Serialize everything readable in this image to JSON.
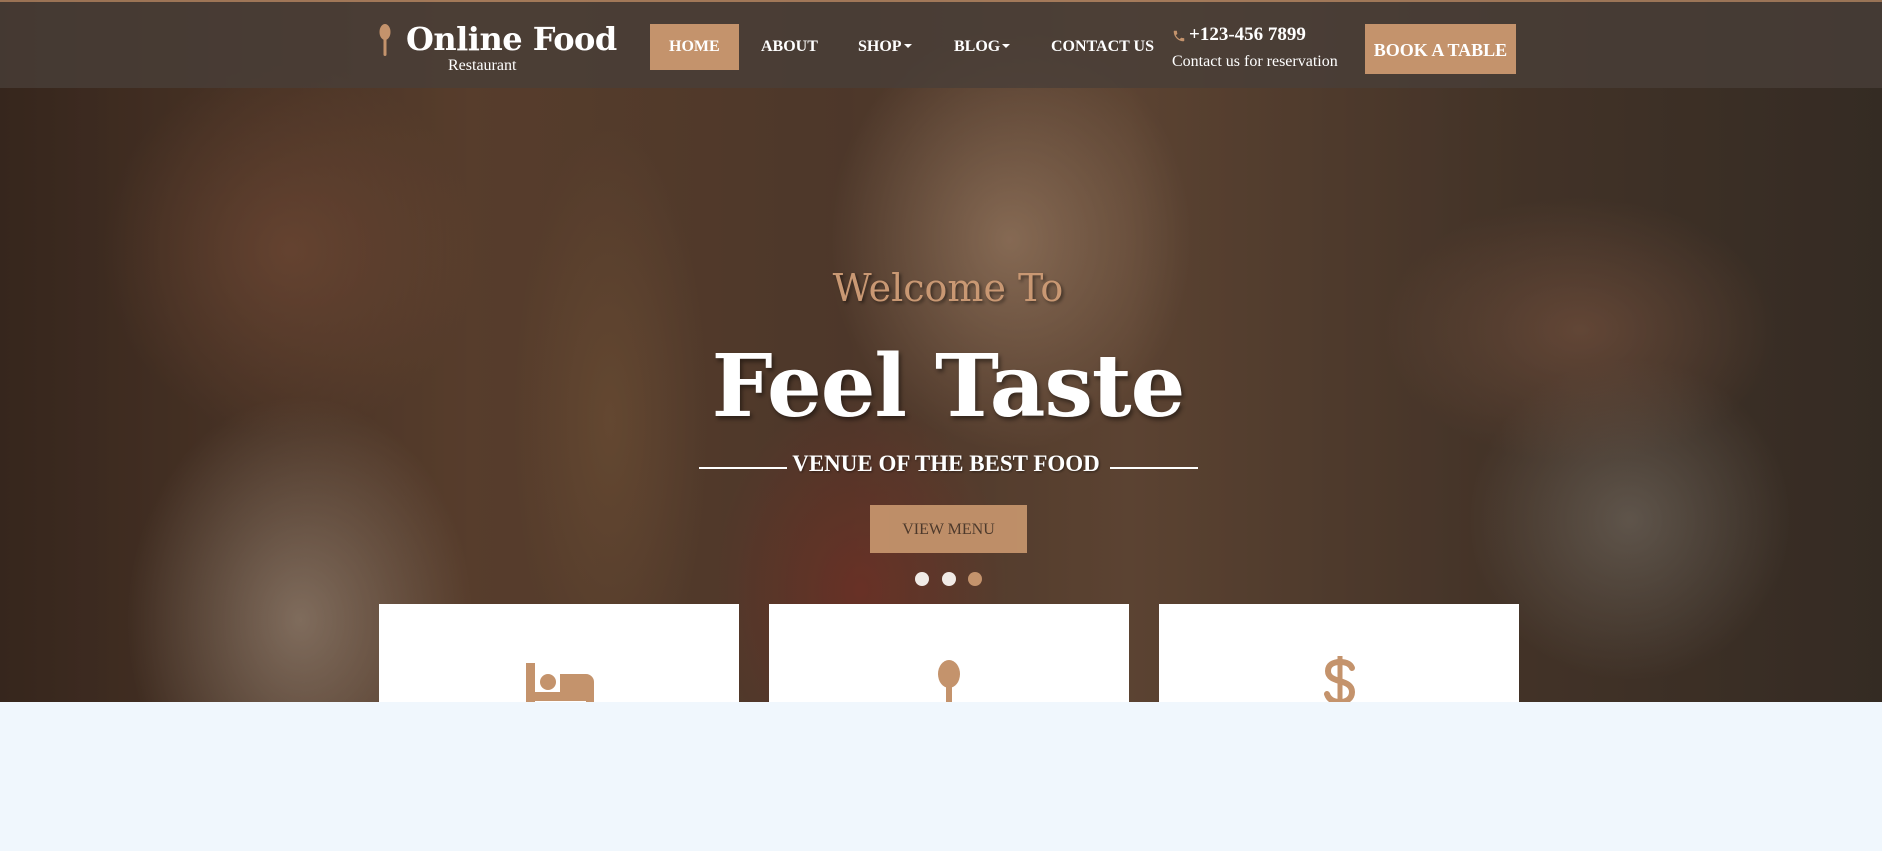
{
  "brand": {
    "name": "Online Food",
    "tagline": "Restaurant",
    "logo_icon": "spoon-icon"
  },
  "nav": {
    "items": [
      {
        "label": "HOME",
        "active": true
      },
      {
        "label": "ABOUT",
        "active": false
      },
      {
        "label": "SHOP",
        "active": false,
        "dropdown": true
      },
      {
        "label": "BLOG",
        "active": false,
        "dropdown": true
      },
      {
        "label": "CONTACT US",
        "active": false
      }
    ]
  },
  "contact": {
    "phone": "+123-456 7899",
    "phone_icon": "phone-icon",
    "subtitle": "Contact us for reservation"
  },
  "cta": {
    "book_label": "BOOK A TABLE"
  },
  "hero": {
    "welcome": "Welcome To",
    "headline": "Feel Taste",
    "subheading": "VENUE OF THE BEST FOOD",
    "button_label": "VIEW MENU",
    "slides_total": 3,
    "active_slide": 3
  },
  "features": [
    {
      "icon": "bed-icon"
    },
    {
      "icon": "spoon-icon"
    },
    {
      "icon": "dollar-icon"
    }
  ],
  "colors": {
    "accent": "#c4936c",
    "navbar_bg": "#4a3e38",
    "page_bg": "#f0f7fd",
    "text_light": "#ffffff"
  }
}
